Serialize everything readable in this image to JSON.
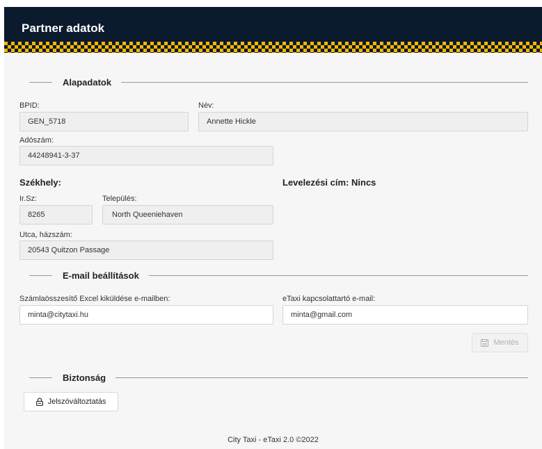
{
  "header": {
    "title": "Partner adatok"
  },
  "sections": {
    "basic": "Alapadatok",
    "email": "E-mail beállítások",
    "security": "Biztonság"
  },
  "basic": {
    "bpid_label": "BPID:",
    "bpid_value": "GEN_5718",
    "name_label": "Név:",
    "name_value": "Annette Hickle",
    "tax_label": "Adószám:",
    "tax_value": "44248941-3-37",
    "seat_heading": "Székhely:",
    "mailing_heading": "Levelezési cím: Nincs",
    "zip_label": "Ir.Sz:",
    "zip_value": "8265",
    "city_label": "Település:",
    "city_value": "North Queeniehaven",
    "street_label": "Utca, házszám:",
    "street_value": "20543 Quitzon Passage"
  },
  "email": {
    "excel_label": "Számlaösszesítő Excel kiküldése e-mailben:",
    "excel_value": "minta@citytaxi.hu",
    "contact_label": "eTaxi kapcsolattartó e-mail:",
    "contact_value": "minta@gmail.com",
    "save_label": "Mentés",
    "save_icon": "save-icon"
  },
  "security": {
    "password_label": "Jelszóváltoztatás",
    "password_icon": "lock-icon"
  },
  "footer": {
    "text": "City Taxi - eTaxi 2.0 ©2022"
  }
}
